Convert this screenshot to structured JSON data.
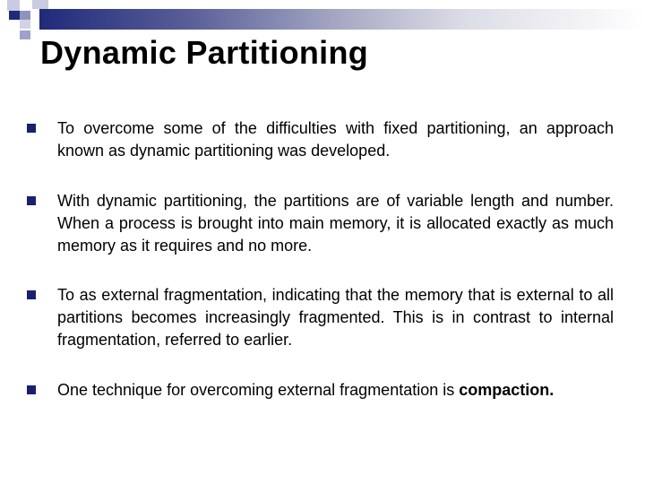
{
  "slide": {
    "title": "Dynamic Partitioning",
    "accent_color": "#1a1f6e",
    "bullets": [
      {
        "text": "To overcome some of the difficulties with fixed partitioning, an approach known as dynamic partitioning was developed."
      },
      {
        "text": "With dynamic partitioning, the partitions are of variable length and number. When a process is brought into main memory, it is allocated exactly as much memory as it requires and no more."
      },
      {
        "text": "To as external fragmentation, indicating that the memory that is external to all partitions becomes increasingly fragmented. This is in contrast to internal fragmentation, referred to earlier."
      },
      {
        "text_before": "One technique for overcoming external fragmentation is ",
        "text_bold": "compaction."
      }
    ]
  }
}
